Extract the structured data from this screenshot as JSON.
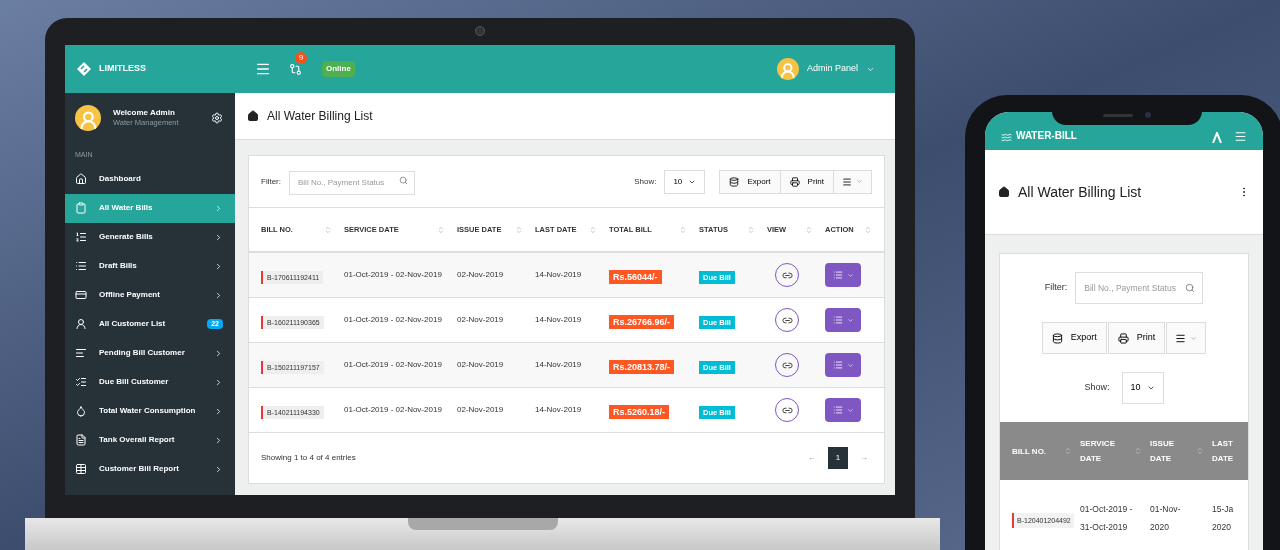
{
  "laptop": {
    "brand": "LIMITLESS",
    "notification_count": "9",
    "status_badge": "Online",
    "user_menu": "Admin Panel",
    "profile": {
      "name": "Welcome Admin",
      "role": "Water Management"
    },
    "nav_heading": "MAIN",
    "nav": [
      {
        "label": "Dashboard",
        "selected": false,
        "submenu": false
      },
      {
        "label": "All Water Bills",
        "selected": true,
        "submenu": true
      },
      {
        "label": "Generate Bills",
        "selected": false,
        "submenu": true
      },
      {
        "label": "Draft Bills",
        "selected": false,
        "submenu": true
      },
      {
        "label": "Offline Payment",
        "selected": false,
        "submenu": true
      },
      {
        "label": "All Customer List",
        "selected": false,
        "submenu": false,
        "badge": "22"
      },
      {
        "label": "Pending Bill Customer",
        "selected": false,
        "submenu": true
      },
      {
        "label": "Due Bill Customer",
        "selected": false,
        "submenu": true
      },
      {
        "label": "Total Water Consumption",
        "selected": false,
        "submenu": true
      },
      {
        "label": "Tank Overall Report",
        "selected": false,
        "submenu": true
      },
      {
        "label": "Customer Bill Report",
        "selected": false,
        "submenu": true
      }
    ],
    "page_title": "All Water Billing List",
    "filter": {
      "label": "Filter:",
      "placeholder": "Bill No., Payment Status"
    },
    "show": {
      "label": "Show:",
      "value": "10"
    },
    "buttons": [
      "Export",
      "Print"
    ],
    "table": {
      "columns": [
        "BILL NO.",
        "SERVICE DATE",
        "ISSUE DATE",
        "LAST DATE",
        "TOTAL BILL",
        "STATUS",
        "VIEW",
        "ACTION"
      ],
      "rows": [
        {
          "bill_no": "B-170611192411",
          "service_date": "01-Oct-2019 - 02-Nov-2019",
          "issue_date": "02-Nov-2019",
          "last_date": "14-Nov-2019",
          "total": "Rs.56044/-",
          "status": "Due Bill"
        },
        {
          "bill_no": "B-160211190365",
          "service_date": "01-Oct-2019 - 02-Nov-2019",
          "issue_date": "02-Nov-2019",
          "last_date": "14-Nov-2019",
          "total": "Rs.26766.96/-",
          "status": "Due Bill"
        },
        {
          "bill_no": "B-150211197157",
          "service_date": "01-Oct-2019 - 02-Nov-2019",
          "issue_date": "02-Nov-2019",
          "last_date": "14-Nov-2019",
          "total": "Rs.20813.78/-",
          "status": "Due Bill"
        },
        {
          "bill_no": "B-140211194330",
          "service_date": "01-Oct-2019 - 02-Nov-2019",
          "issue_date": "02-Nov-2019",
          "last_date": "14-Nov-2019",
          "total": "Rs.5260.18/-",
          "status": "Due Bill"
        }
      ]
    },
    "footer": "Showing 1 to 4 of 4 entries",
    "pagination": {
      "prev": "←",
      "next": "→",
      "pages": [
        {
          "label": "1",
          "selected": true
        }
      ]
    }
  },
  "phone": {
    "brand": "WATER-BILL",
    "page_title": "All Water Billing List",
    "filter": {
      "label": "Filter:",
      "placeholder": "Bill No., Payment Status"
    },
    "buttons": [
      "Export",
      "Print"
    ],
    "show": {
      "label": "Show:",
      "value": "10"
    },
    "table": {
      "columns": [
        "BILL NO.",
        "SERVICE DATE",
        "ISSUE DATE",
        "LAST DATE"
      ],
      "rows": [
        {
          "bill_no": "B-120401204492",
          "service_date": "01-Oct-2019 - 31-Oct-2019",
          "issue_date": "01-Nov-2020",
          "last_date": "15-Ja 2020"
        }
      ]
    }
  }
}
